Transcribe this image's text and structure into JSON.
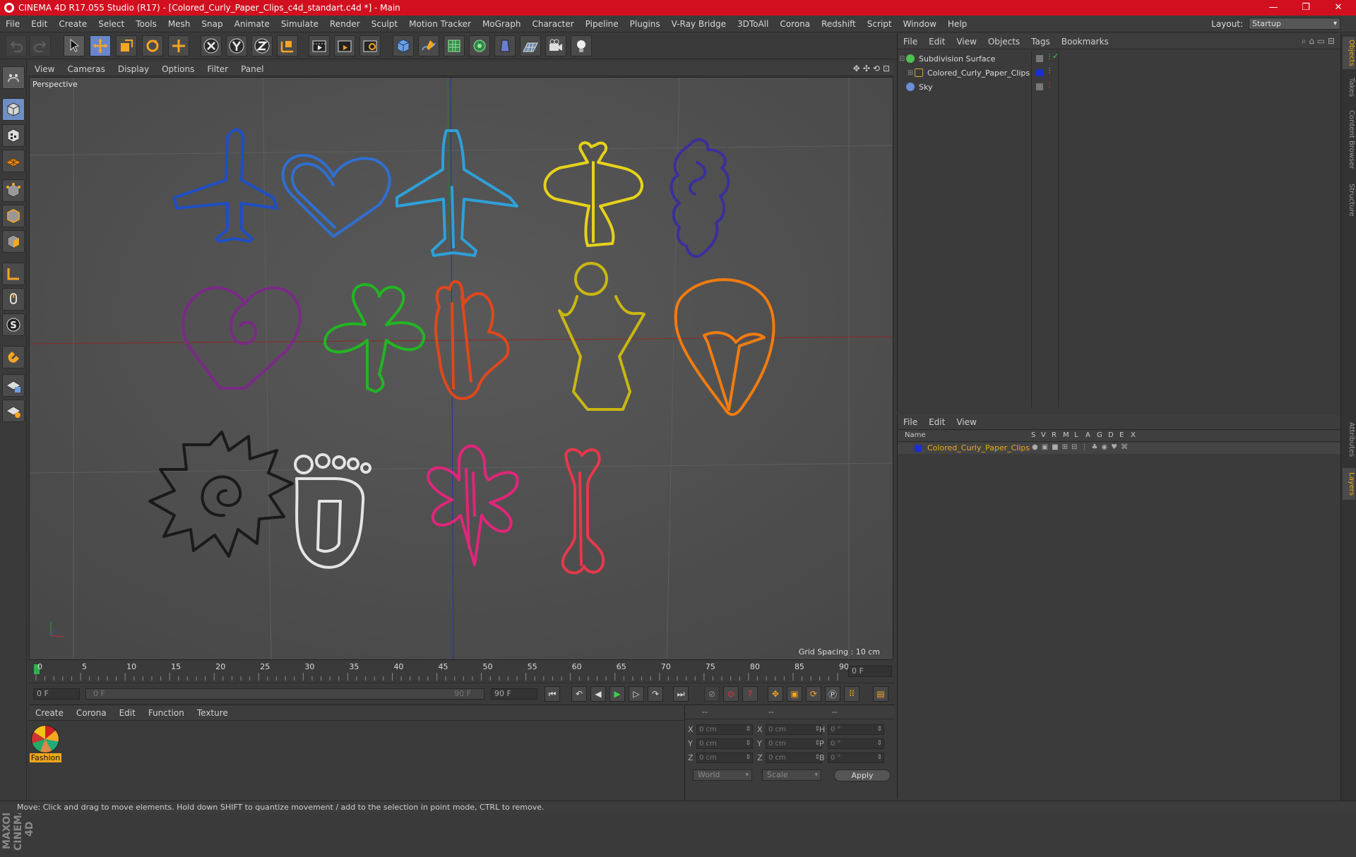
{
  "window": {
    "title": "CINEMA 4D R17.055 Studio (R17) - [Colored_Curly_Paper_Clips_c4d_standart.c4d *] - Main",
    "controls": [
      "—",
      "❐",
      "✕"
    ]
  },
  "menubar": {
    "items": [
      "File",
      "Edit",
      "Create",
      "Select",
      "Tools",
      "Mesh",
      "Snap",
      "Animate",
      "Simulate",
      "Render",
      "Sculpt",
      "Motion Tracker",
      "MoGraph",
      "Character",
      "Pipeline",
      "Plugins",
      "V-Ray Bridge",
      "3DToAll",
      "Corona",
      "Redshift",
      "Script",
      "Window",
      "Help"
    ],
    "layout_label": "Layout:",
    "layout_value": "Startup"
  },
  "viewport": {
    "menu": [
      "View",
      "Cameras",
      "Display",
      "Options",
      "Filter",
      "Panel"
    ],
    "camera_label": "Perspective",
    "grid_spacing": "Grid Spacing : 10 cm",
    "nav_icons": [
      "✥",
      "✣",
      "⟲",
      "⊡"
    ]
  },
  "timeline": {
    "ticks": [
      "0",
      "5",
      "10",
      "15",
      "20",
      "25",
      "30",
      "35",
      "40",
      "45",
      "50",
      "55",
      "60",
      "65",
      "70",
      "75",
      "80",
      "85",
      "90"
    ],
    "current_frame": "0 F",
    "start_field": "0 F",
    "range_start": "0 F",
    "range_end": "90 F",
    "end_field": "90 F"
  },
  "material_manager": {
    "menu": [
      "Create",
      "Corona",
      "Edit",
      "Function",
      "Texture"
    ],
    "materials": [
      {
        "name": "Fashion"
      }
    ]
  },
  "coordinates": {
    "header": [
      "--",
      "--",
      "--"
    ],
    "rows": [
      {
        "a": "X",
        "av": "0 cm",
        "b": "X",
        "bv": "0 cm",
        "c": "H",
        "cv": "0 °"
      },
      {
        "a": "Y",
        "av": "0 cm",
        "b": "Y",
        "bv": "0 cm",
        "c": "P",
        "cv": "0 °"
      },
      {
        "a": "Z",
        "av": "0 cm",
        "b": "Z",
        "bv": "0 cm",
        "c": "B",
        "cv": "0 °"
      }
    ],
    "mode1": "World",
    "mode2": "Scale",
    "apply": "Apply"
  },
  "object_manager": {
    "menu": [
      "File",
      "Edit",
      "View",
      "Objects",
      "Tags",
      "Bookmarks"
    ],
    "objects": [
      {
        "name": "Subdivision Surface",
        "color": "#4ec24e"
      },
      {
        "name": "Colored_Curly_Paper_Clips",
        "color": "#d9a43a"
      },
      {
        "name": "Sky",
        "color": "#6b8fd6"
      }
    ]
  },
  "layer_manager": {
    "menu": [
      "File",
      "Edit",
      "View"
    ],
    "columns": [
      "Name",
      "S",
      "V",
      "R",
      "M",
      "L",
      "A",
      "G",
      "D",
      "E",
      "X"
    ],
    "layers": [
      {
        "name": "Colored_Curly_Paper_Clips",
        "color": "#1b2fd0"
      }
    ]
  },
  "side_tabs": [
    "Objects",
    "Takes",
    "Content Browser",
    "Structure",
    "Attributes",
    "Layers"
  ],
  "status": "Move: Click and drag to move elements. Hold down SHIFT to quantize movement / add to the selection in point mode, CTRL to remove.",
  "brand": "MAXON CINEMA 4D",
  "scene_clips": [
    {
      "name": "airplane-small",
      "color": "#1f4fc4"
    },
    {
      "name": "heart",
      "color": "#2f6fd0"
    },
    {
      "name": "airplane-large",
      "color": "#2ea0d8"
    },
    {
      "name": "butterfly",
      "color": "#e6d21a"
    },
    {
      "name": "grapes",
      "color": "#3b2f9a"
    },
    {
      "name": "heart-swirl",
      "color": "#7a2a86"
    },
    {
      "name": "clover",
      "color": "#22b522"
    },
    {
      "name": "anatomical-heart",
      "color": "#e0471c"
    },
    {
      "name": "angel",
      "color": "#c9b613"
    },
    {
      "name": "parachute",
      "color": "#f07c10"
    },
    {
      "name": "sun",
      "color": "#1a1a1a"
    },
    {
      "name": "foot",
      "color": "#e4e4e4"
    },
    {
      "name": "dragonfly",
      "color": "#e0267a"
    },
    {
      "name": "bone",
      "color": "#e8384a"
    }
  ]
}
